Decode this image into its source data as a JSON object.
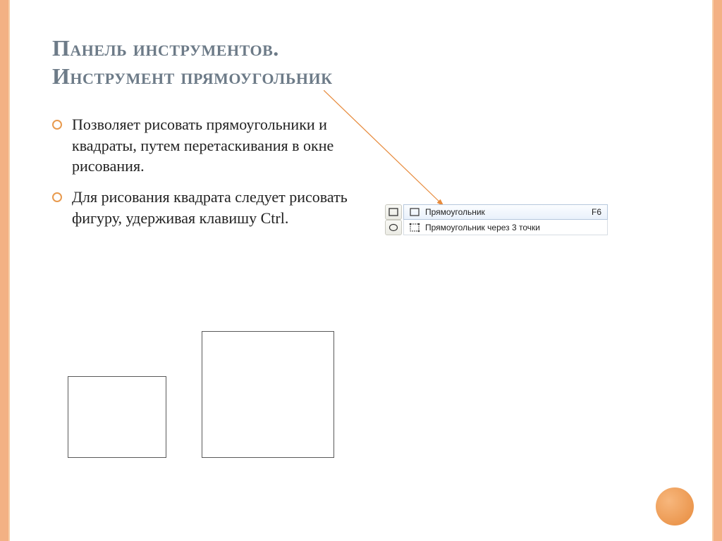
{
  "title_line1": "Панель инструментов.",
  "title_line2": "Инструмент прямоугольник",
  "bullets": [
    "Позволяет рисовать прямоугольники и квадраты, путем перетаскивания в окне рисования.",
    "Для рисования квадрата следует рисовать фигуру, удерживая клавишу Ctrl."
  ],
  "toolbar": {
    "item1_label": "Прямоугольник",
    "item1_shortcut": "F6",
    "item2_label": "Прямоугольник через 3 точки",
    "item2_shortcut": ""
  },
  "icons": {
    "rect_tool": "rectangle-icon",
    "ellipse_tool": "ellipse-icon",
    "rect_3pt": "rectangle-3pt-icon"
  },
  "colors": {
    "accent": "#e78b3d",
    "title": "#6d7b88"
  }
}
